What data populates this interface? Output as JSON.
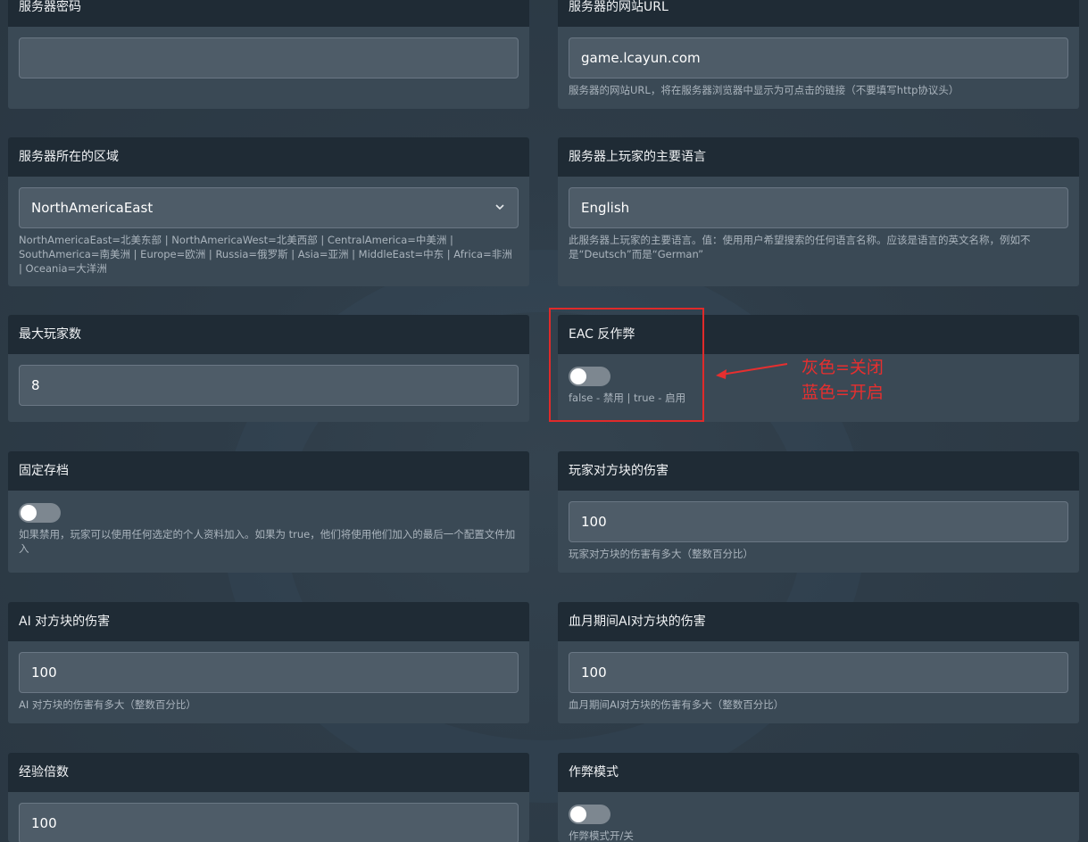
{
  "cards": {
    "server_password": {
      "title": "服务器密码",
      "value": ""
    },
    "server_url": {
      "title": "服务器的网站URL",
      "value": "game.lcayun.com",
      "help": "服务器的网站URL，将在服务器浏览器中显示为可点击的链接（不要填写http协议头）"
    },
    "server_region": {
      "title": "服务器所在的区域",
      "value": "NorthAmericaEast",
      "help": "NorthAmericaEast=北美东部 | NorthAmericaWest=北美西部 | CentralAmerica=中美洲 | SouthAmerica=南美洲 | Europe=欧洲 | Russia=俄罗斯 | Asia=亚洲 | MiddleEast=中东 | Africa=非洲 | Oceania=大洋洲"
    },
    "server_language": {
      "title": "服务器上玩家的主要语言",
      "value": "English",
      "help": "此服务器上玩家的主要语言。值：使用用户希望搜索的任何语言名称。应该是语言的英文名称，例如不是“Deutsch”而是“German”"
    },
    "max_players": {
      "title": "最大玩家数",
      "value": "8"
    },
    "eac": {
      "title": "EAC 反作弊",
      "help": "false - 禁用 | true - 启用",
      "enabled": false
    },
    "fixed_save": {
      "title": "固定存档",
      "help": "如果禁用，玩家可以使用任何选定的个人资料加入。如果为 true，他们将使用他们加入的最后一个配置文件加入",
      "enabled": false
    },
    "player_block_damage": {
      "title": "玩家对方块的伤害",
      "value": "100",
      "help": "玩家对方块的伤害有多大（整数百分比）"
    },
    "ai_block_damage": {
      "title": "AI 对方块的伤害",
      "value": "100",
      "help": "AI 对方块的伤害有多大（整数百分比）"
    },
    "bloodmoon_ai_block_damage": {
      "title": "血月期间AI对方块的伤害",
      "value": "100",
      "help": "血月期间AI对方块的伤害有多大（整数百分比）"
    },
    "xp_multiplier": {
      "title": "经验倍数",
      "value": "100"
    },
    "cheat_mode": {
      "title": "作弊模式",
      "help": "作弊模式开/关",
      "enabled": false
    }
  },
  "annotation": {
    "line1": "灰色=关闭",
    "line2": "蓝色=开启",
    "color": "#e62f2f"
  },
  "icons": {
    "select": "chevron-down-icon",
    "arrow": "arrow-left-icon"
  }
}
